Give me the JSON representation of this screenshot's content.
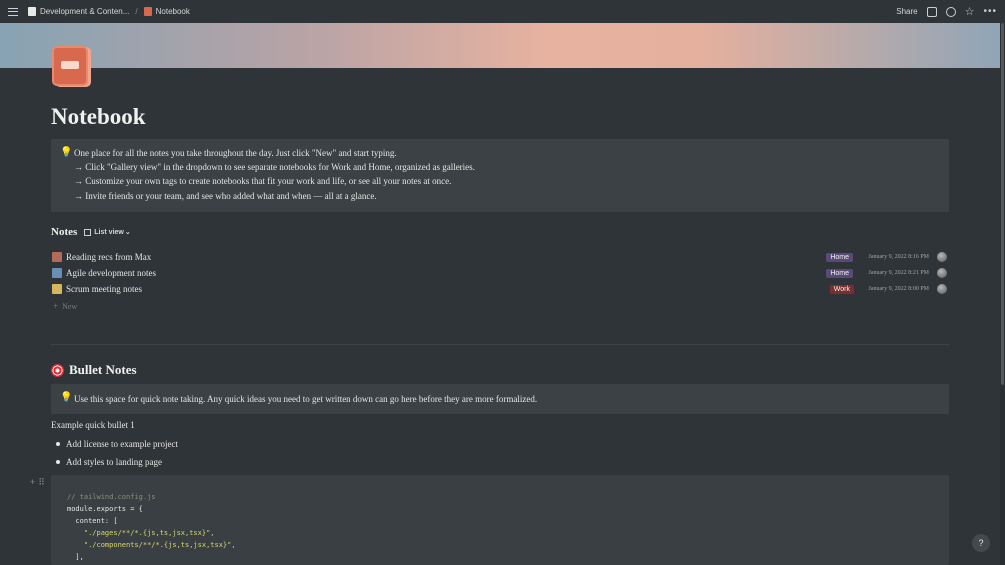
{
  "topbar": {
    "breadcrumb_parent": "Development & Conten...",
    "breadcrumb_sep": "/",
    "breadcrumb_current": "Notebook",
    "share_label": "Share",
    "more_label": "•••"
  },
  "page": {
    "title": "Notebook"
  },
  "intro_callout": {
    "icon": "lightbulb-icon",
    "lines": [
      "One place for all the notes you take throughout the day. Just click \"New\" and start typing.",
      "→ Click \"Gallery view\" in the dropdown to see separate notebooks for Work and Home, organized as galleries.",
      "→ Customize your own tags to create notebooks that fit your work and life, or see all your notes at once.",
      "→ Invite friends or your team, and see who added what and when — all at a glance."
    ]
  },
  "notes": {
    "title": "Notes",
    "view_label": "List view",
    "view_chevron": "⌄",
    "rows": [
      {
        "label": "Reading recs from Max",
        "tag": "Home",
        "date": "January 9, 2022 8:16 PM"
      },
      {
        "label": "Agile development notes",
        "tag": "Home",
        "date": "January 9, 2022 8:21 PM"
      },
      {
        "label": "Scrum meeting notes",
        "tag": "Work",
        "date": "January 9, 2022 8:00 PM"
      }
    ],
    "new_label": "New"
  },
  "bullet_section": {
    "title": "Bullet Notes",
    "callout": "Use this space for quick note taking. Any quick ideas you need to get written down can go here before they are more formalized.",
    "paragraph": "Example quick bullet 1",
    "bullets": [
      "Add license to example project",
      "Add styles to landing page"
    ]
  },
  "code_block": {
    "lines": [
      "// tailwind.config.js",
      "module.exports = {",
      "  content: [",
      "    \"./pages/**/*.{js,ts,jsx,tsx}\",",
      "    \"./components/**/*.{js,ts,jsx,tsx}\",",
      "  ],"
    ]
  },
  "help": {
    "label": "?"
  },
  "colors": {
    "background": "#2f3438",
    "callout": "#3c4145",
    "tag_home": "#5a4a7a",
    "tag_work": "#7a2f2f"
  }
}
